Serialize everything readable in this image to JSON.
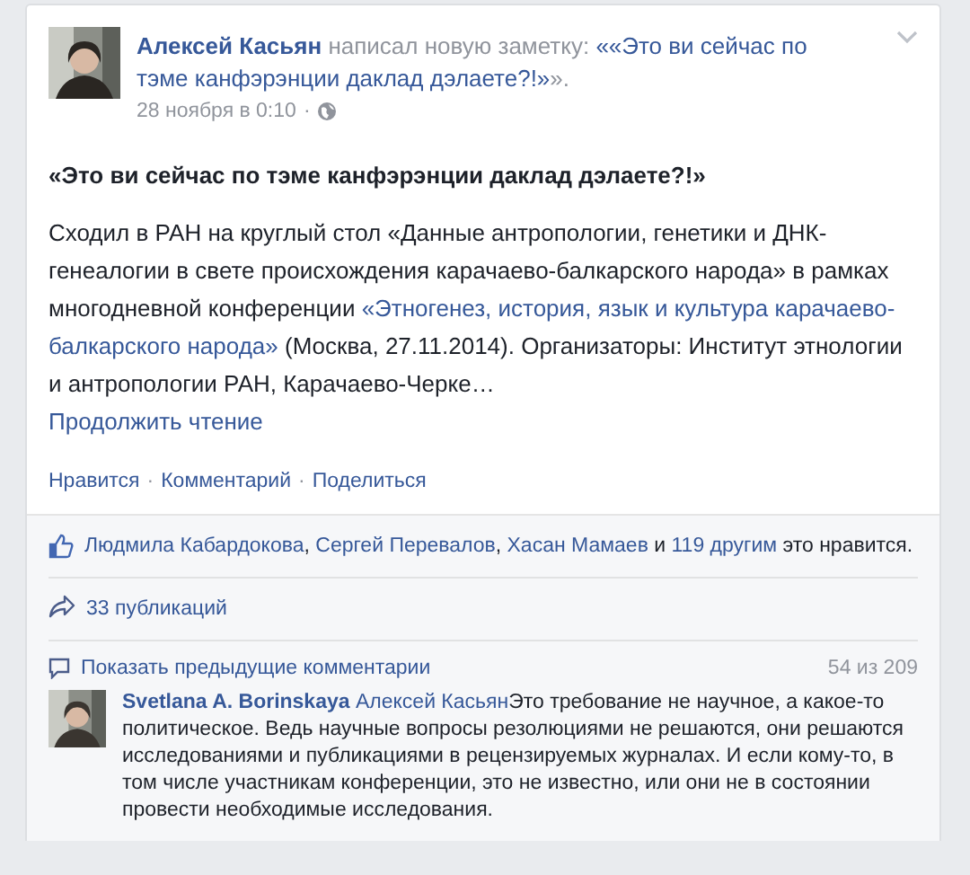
{
  "post": {
    "header": [
      {
        "kind": "author",
        "text": "Алексей Касьян"
      },
      {
        "kind": "plain",
        "text": " написал новую заметку: "
      },
      {
        "kind": "link",
        "text": "««Это ви сейчас по тэме канфэрэнции даклад дэлаете?!»"
      },
      {
        "kind": "plain",
        "text": "»."
      }
    ],
    "time": "28 ноября в 0:10",
    "separator": "·",
    "title": "«Это ви сейчас по тэме канфэрэнции даклад дэлаете?!»",
    "body": [
      {
        "kind": "text",
        "text": "Сходил в РАН на круглый стол «Данные антропологии, генетики и ДНК-генеалогии в свете происхождения карачаево-балкарского народа» в рамках многодневной конференции "
      },
      {
        "kind": "link",
        "text": "«Этногенез, история, язык и культура карачаево-балкарского народа»"
      },
      {
        "kind": "text",
        "text": " (Москва, 27.11.2014). Организаторы: Институт этнологии и антропологии РАН, Карачаево-Черке…"
      }
    ],
    "read_more": "Продолжить чтение",
    "actions": [
      "Нравится",
      "Комментарий",
      "Поделиться"
    ]
  },
  "likes": [
    {
      "kind": "link",
      "text": "Людмила Кабардокова"
    },
    {
      "kind": "text",
      "text": ", "
    },
    {
      "kind": "link",
      "text": "Сергей Перевалов"
    },
    {
      "kind": "text",
      "text": ", "
    },
    {
      "kind": "link",
      "text": "Хасан Мамаев"
    },
    {
      "kind": "text",
      "text": " и "
    },
    {
      "kind": "link",
      "text": "119 другим"
    },
    {
      "kind": "text",
      "text": " это нравится."
    }
  ],
  "shares": "33 публикаций",
  "comments": {
    "show_previous": "Показать предыдущие комментарии",
    "count": "54 из 209",
    "items": [
      {
        "author": "Svetlana A. Borinskaya",
        "mention": "Алексей Касьян",
        "text": "Это требование не научное, а какое-то политическое. Ведь научные вопросы резолюциями не решаются, они решаются исследованиями и публикациями в рецензируемых журналах. И если кому-то, в том числе участникам конференции, это не известно, или они не в состоянии провести необходимые исследования."
      }
    ]
  }
}
